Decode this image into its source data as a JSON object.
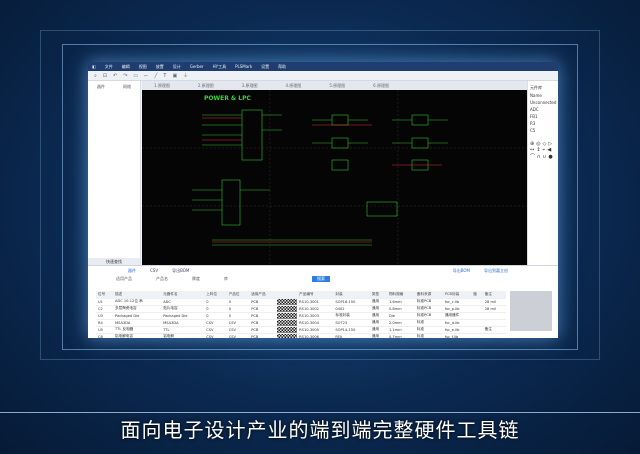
{
  "subtitle": "面向电子设计产业的端到端完整硬件工具链",
  "menu": [
    "文件",
    "编辑",
    "视图",
    "放置",
    "设计",
    "Gerber",
    "HY工具",
    "PLSMark",
    "设置",
    "帮助"
  ],
  "left_panel": {
    "tabs": [
      "器件",
      "网络"
    ],
    "footer": "快速查找"
  },
  "canvas_tabs": [
    "1.原理图",
    "2.原理图",
    "3.原理图",
    "4.原理图",
    "5.原理图",
    "6.原理图"
  ],
  "schematic_title": "POWER & LPC",
  "right_panel": {
    "title": "元件库",
    "items": [
      "Name",
      "Unconnected",
      "ADC",
      "FB1",
      "R3",
      "C5"
    ]
  },
  "bottom": {
    "tabs": [
      "器件",
      "CSV",
      "导出BOM"
    ],
    "search_button": "搜索",
    "filters": [
      "适用产品",
      "产品名",
      "厚度",
      "库"
    ],
    "right_links": [
      "导出BOM",
      "导出到嘉立创"
    ],
    "columns": [
      "位号",
      "描述",
      "元器件名",
      "上料位",
      "产品位",
      "适用产品",
      "",
      "产品编号",
      "封装",
      "类型",
      "物料规格",
      "备料来源",
      "PCB封装",
      "值",
      "备注"
    ],
    "rows": [
      [
        "U1",
        "ADC 10-12位 串",
        "ADC",
        "0",
        "0",
        "PCB",
        "",
        "RS10-3001",
        "SOP16-150",
        "通用",
        "1.6mm",
        "标准PCB",
        "fsc_c.lib",
        "",
        "28 mil"
      ],
      [
        "C2",
        "多层陶瓷电容",
        "贴片电容",
        "0",
        "0",
        "PCB",
        "",
        "RS10-3002",
        "0402",
        "通用",
        "0.8mm",
        "标准PCB",
        "fsc_p.lib",
        "",
        "28 mil"
      ],
      [
        "U3",
        "Packaged Die",
        "Packaged Die",
        "0",
        "0",
        "PCB",
        "",
        "RS10-3003",
        "标准封装",
        "通用",
        "Die",
        "标准PCB",
        "通用器件",
        "",
        ""
      ],
      [
        "R4",
        "MSA3DA",
        "MSA3DA",
        "CSV",
        "CSV",
        "PCB",
        "",
        "RS10-3004",
        "SOT23",
        "通用",
        "2.0mm",
        "标准",
        "fsc_d.lib",
        "",
        ""
      ],
      [
        "U5",
        "TTL 反相器",
        "TTL",
        "CSV",
        "CSV",
        "PCB",
        "",
        "RS10-3005",
        "SOP14-150",
        "通用",
        "1.1mm",
        "标准",
        "fsc_e.lib",
        "",
        "备注"
      ],
      [
        "C6",
        "铝电解电容",
        "铝电解",
        "CSV",
        "CSV",
        "PCB",
        "",
        "RS10-3006",
        "RFA",
        "通用",
        "0.7mm",
        "标准",
        "fsc_f.lib",
        "",
        ""
      ]
    ]
  }
}
